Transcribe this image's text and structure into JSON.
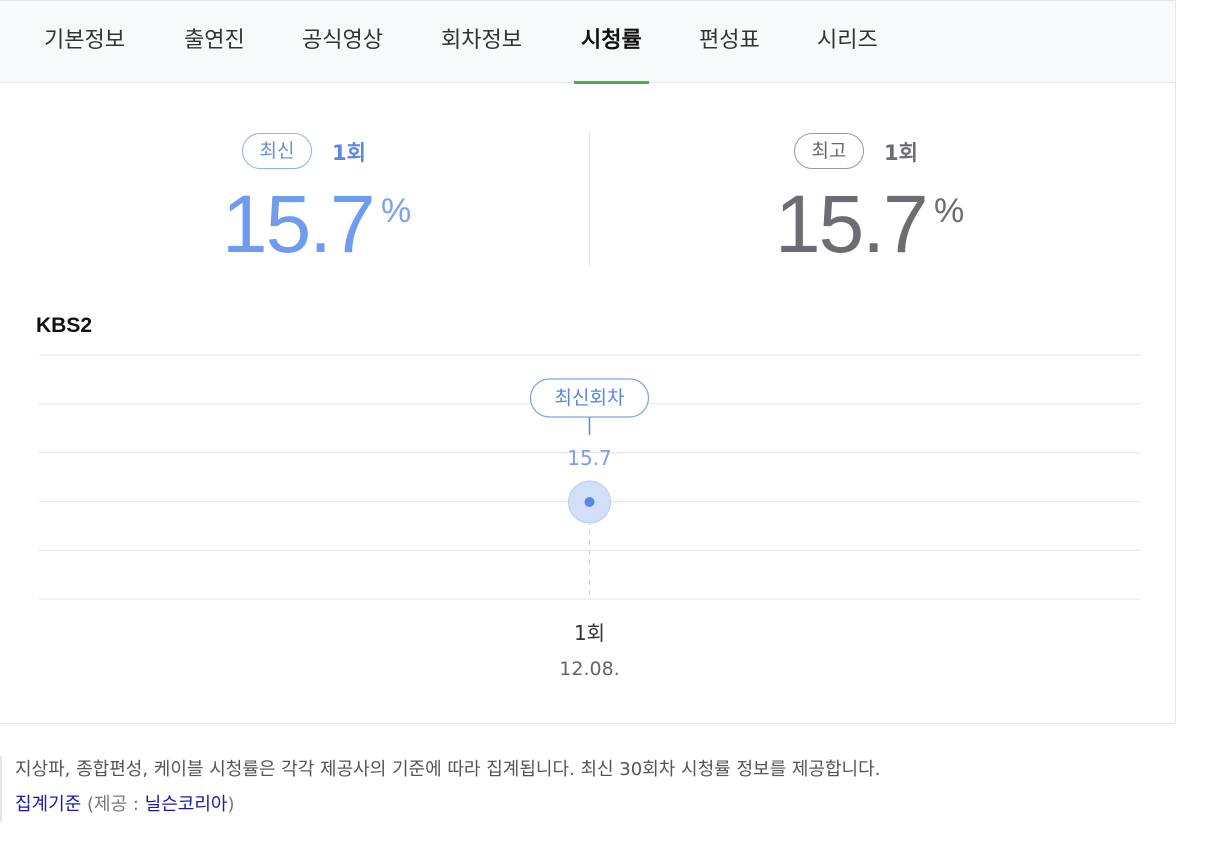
{
  "tabs": [
    {
      "label": "기본정보",
      "active": false
    },
    {
      "label": "출연진",
      "active": false
    },
    {
      "label": "공식영상",
      "active": false
    },
    {
      "label": "회차정보",
      "active": false
    },
    {
      "label": "시청률",
      "active": true
    },
    {
      "label": "편성표",
      "active": false
    },
    {
      "label": "시리즈",
      "active": false
    }
  ],
  "summary": {
    "latest": {
      "badge": "최신",
      "episode": "1회",
      "value": "15.7",
      "unit": "%"
    },
    "best": {
      "badge": "최고",
      "episode": "1회",
      "value": "15.7",
      "unit": "%"
    }
  },
  "channel": "KBS2",
  "chart_data": {
    "type": "scatter",
    "categories": [
      "1회"
    ],
    "dates": [
      "12.08."
    ],
    "series": [
      {
        "values": [
          15.7
        ]
      }
    ],
    "data_labels": [
      "15.7"
    ],
    "annotation": "최신회차",
    "grid": true,
    "gridline_count": 6
  },
  "footer": {
    "note": "지상파, 종합편성, 케이블 시청률은 각각 제공사의 기준에 따라 집계됩니다. 최신 30회차 시청률 정보를 제공합니다.",
    "criteria_link": "집계기준",
    "provider_prefix": "(제공 : ",
    "provider_link": "닐슨코리아",
    "provider_suffix": ")"
  },
  "colors": {
    "accent_blue": "#6f9cf0",
    "active_tab_underline": "#4cb050",
    "best_gray": "#6b6d73",
    "link": "#1a1aa6"
  }
}
